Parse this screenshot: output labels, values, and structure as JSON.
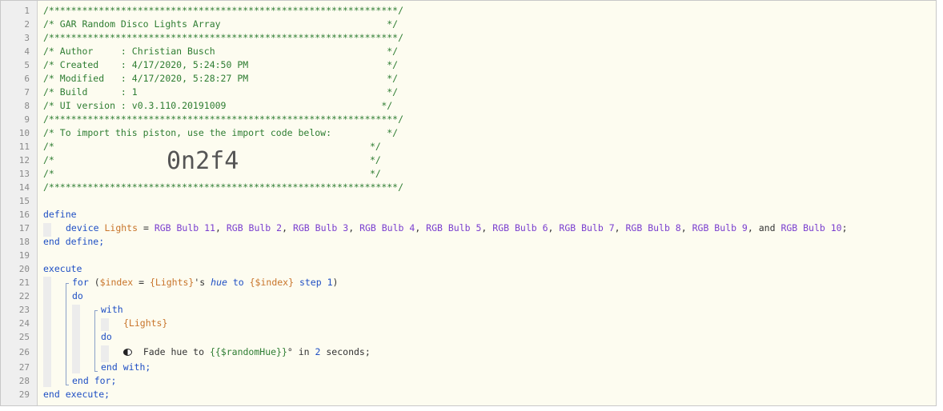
{
  "header": {
    "border": "/***************************************************************/",
    "title": "/* GAR Random Disco Lights Array                              */",
    "author": "/* Author     : Christian Busch                               */",
    "created": "/* Created    : 4/17/2020, 5:24:50 PM                         */",
    "modified": "/* Modified   : 4/17/2020, 5:28:27 PM                         */",
    "build": "/* Build      : 1                                             */",
    "ui_version": "/* UI version : v0.3.110.20191009                            */",
    "import_note": "/* To import this piston, use the import code below:          */",
    "blank_prefix": "/*",
    "blank_suffix": "*/",
    "import_code": "0n2f4"
  },
  "line_numbers": [
    "1",
    "2",
    "3",
    "4",
    "5",
    "6",
    "7",
    "8",
    "9",
    "10",
    "11",
    "12",
    "13",
    "14",
    "15",
    "16",
    "17",
    "18",
    "19",
    "20",
    "21",
    "22",
    "23",
    "24",
    "25",
    "26",
    "27",
    "28",
    "29"
  ],
  "define": {
    "keyword": "define",
    "device_kw": "device",
    "var_name": "Lights",
    "assign": " = ",
    "devices": [
      "RGB Bulb 11",
      "RGB Bulb 2",
      "RGB Bulb 3",
      "RGB Bulb 4",
      "RGB Bulb 5",
      "RGB Bulb 6",
      "RGB Bulb 7",
      "RGB Bulb 8",
      "RGB Bulb 9"
    ],
    "and_kw": "and",
    "last_device": "RGB Bulb 10",
    "end": "end define;"
  },
  "execute": {
    "keyword": "execute",
    "for_kw": "for",
    "open_paren": " (",
    "index_var": "$index",
    "eq": " = ",
    "lights_ref": "{Lights}",
    "possessive": "'s ",
    "hue_attr": "hue",
    "to_kw": " to ",
    "index_ref": "{$index}",
    "step_kw": " step ",
    "step_val": "1",
    "close_paren": ")",
    "do_kw": "do",
    "with_kw": "with",
    "with_lights": "{Lights}",
    "inner_do": "do",
    "task_prefix": "Fade hue to ",
    "task_expr": "{{$randomHue}}",
    "task_mid": "° in ",
    "task_num": "2",
    "task_suffix": " seconds;",
    "end_with": "end with;",
    "end_for": "end for;",
    "end_execute": "end execute;"
  }
}
